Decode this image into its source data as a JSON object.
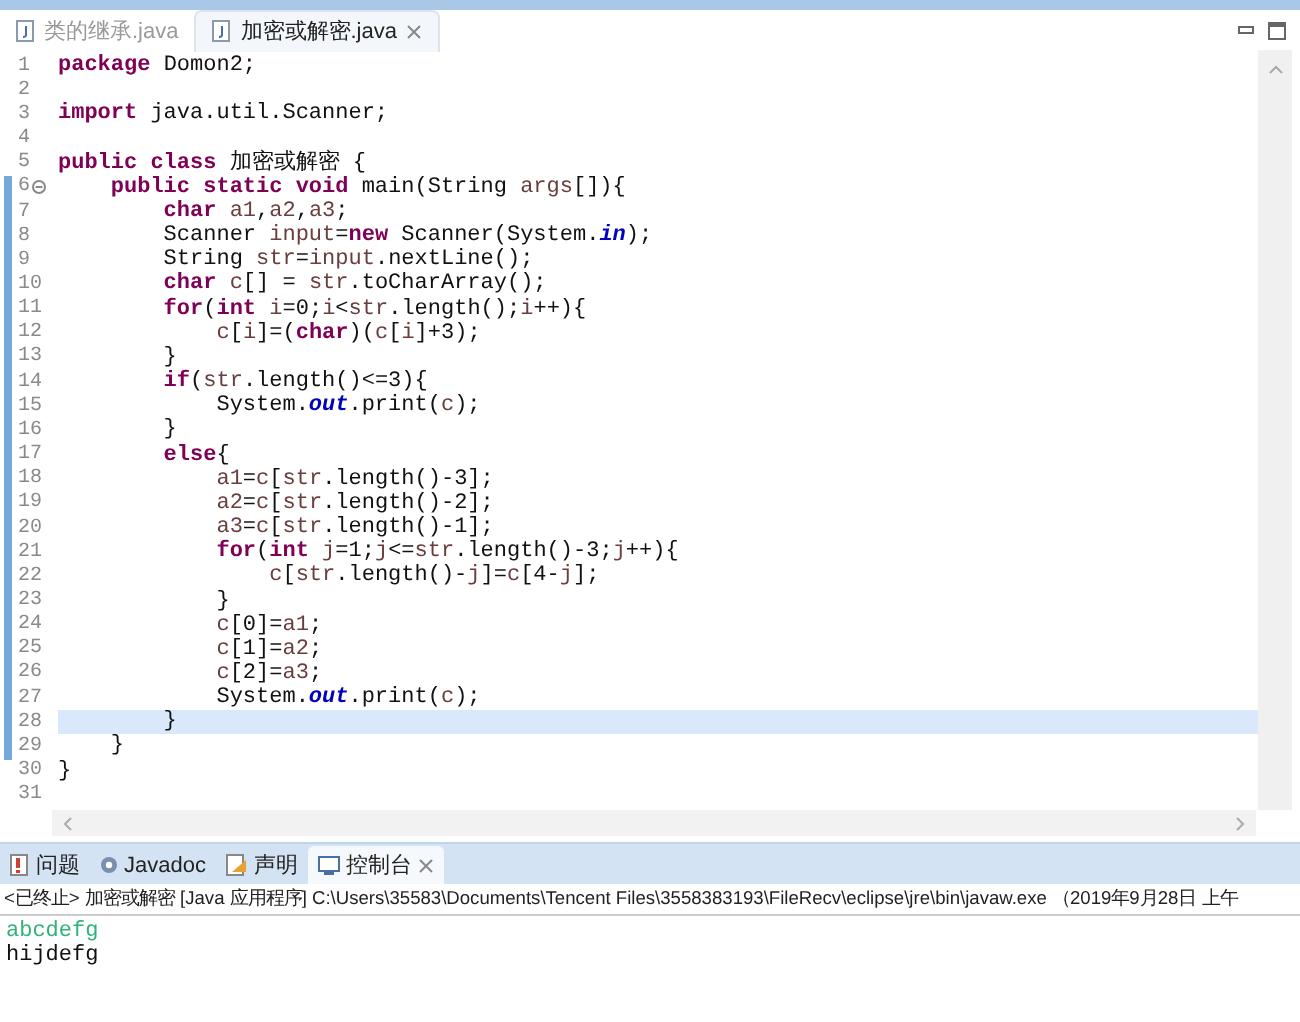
{
  "editor_tabs": [
    {
      "label": "类的继承.java",
      "selected": false
    },
    {
      "label": "加密或解密.java",
      "selected": true
    }
  ],
  "code_lines": [
    {
      "number": "1",
      "changed": false,
      "current": false,
      "fold": false,
      "tokens": [
        {
          "kind": "keyword",
          "text": "package"
        },
        {
          "kind": "plain",
          "text": " Domon2;"
        }
      ]
    },
    {
      "number": "2",
      "changed": false,
      "current": false,
      "fold": false
    },
    {
      "number": "3",
      "changed": false,
      "current": false,
      "fold": false,
      "tokens": [
        {
          "kind": "keyword",
          "text": "import"
        },
        {
          "kind": "plain",
          "text": " java.util.Scanner;"
        }
      ]
    },
    {
      "number": "4",
      "changed": false,
      "current": false,
      "fold": false
    },
    {
      "number": "5",
      "changed": false,
      "current": false,
      "fold": false,
      "tokens": [
        {
          "kind": "keyword",
          "text": "public class"
        },
        {
          "kind": "plain",
          "text": " 加密或解密 {"
        }
      ]
    },
    {
      "number": "6",
      "changed": true,
      "current": false,
      "fold": true,
      "tokens": [
        {
          "kind": "keyword",
          "text": "    public static void"
        },
        {
          "kind": "plain",
          "text": " main(String "
        },
        {
          "kind": "variable",
          "text": "args"
        },
        {
          "kind": "plain",
          "text": "[]){"
        }
      ]
    },
    {
      "number": "7",
      "changed": true,
      "current": false,
      "fold": false,
      "tokens": [
        {
          "kind": "keyword",
          "text": "        char"
        },
        {
          "kind": "variable",
          "text": " a1"
        },
        {
          "kind": "plain",
          "text": ","
        },
        {
          "kind": "variable",
          "text": "a2"
        },
        {
          "kind": "plain",
          "text": ","
        },
        {
          "kind": "variable",
          "text": "a3"
        },
        {
          "kind": "plain",
          "text": ";"
        }
      ]
    },
    {
      "number": "8",
      "changed": true,
      "current": false,
      "fold": false,
      "tokens": [
        {
          "kind": "plain",
          "text": "        Scanner "
        },
        {
          "kind": "variable",
          "text": "input"
        },
        {
          "kind": "plain",
          "text": "="
        },
        {
          "kind": "keyword",
          "text": "new"
        },
        {
          "kind": "plain",
          "text": " Scanner(System."
        },
        {
          "kind": "field",
          "text": "in"
        },
        {
          "kind": "plain",
          "text": ");"
        }
      ]
    },
    {
      "number": "9",
      "changed": true,
      "current": false,
      "fold": false,
      "tokens": [
        {
          "kind": "plain",
          "text": "        String "
        },
        {
          "kind": "variable",
          "text": "str"
        },
        {
          "kind": "plain",
          "text": "="
        },
        {
          "kind": "variable",
          "text": "input"
        },
        {
          "kind": "plain",
          "text": ".nextLine();"
        }
      ]
    },
    {
      "number": "10",
      "changed": true,
      "current": false,
      "fold": false,
      "tokens": [
        {
          "kind": "keyword",
          "text": "        char"
        },
        {
          "kind": "variable",
          "text": " c"
        },
        {
          "kind": "plain",
          "text": "[] = "
        },
        {
          "kind": "variable",
          "text": "str"
        },
        {
          "kind": "plain",
          "text": ".toCharArray();"
        }
      ]
    },
    {
      "number": "11",
      "changed": true,
      "current": false,
      "fold": false,
      "tokens": [
        {
          "kind": "keyword",
          "text": "        for"
        },
        {
          "kind": "plain",
          "text": "("
        },
        {
          "kind": "keyword",
          "text": "int"
        },
        {
          "kind": "variable",
          "text": " i"
        },
        {
          "kind": "plain",
          "text": "=0;"
        },
        {
          "kind": "variable",
          "text": "i"
        },
        {
          "kind": "plain",
          "text": "<"
        },
        {
          "kind": "variable",
          "text": "str"
        },
        {
          "kind": "plain",
          "text": ".length();"
        },
        {
          "kind": "variable",
          "text": "i"
        },
        {
          "kind": "plain",
          "text": "++){"
        }
      ]
    },
    {
      "number": "12",
      "changed": true,
      "current": false,
      "fold": false,
      "tokens": [
        {
          "kind": "variable",
          "text": "            c"
        },
        {
          "kind": "plain",
          "text": "["
        },
        {
          "kind": "variable",
          "text": "i"
        },
        {
          "kind": "plain",
          "text": "]=("
        },
        {
          "kind": "keyword",
          "text": "char"
        },
        {
          "kind": "plain",
          "text": ")("
        },
        {
          "kind": "variable",
          "text": "c"
        },
        {
          "kind": "plain",
          "text": "["
        },
        {
          "kind": "variable",
          "text": "i"
        },
        {
          "kind": "plain",
          "text": "]+3);"
        }
      ]
    },
    {
      "number": "13",
      "changed": true,
      "current": false,
      "fold": false,
      "tokens": [
        {
          "kind": "plain",
          "text": "        }"
        }
      ]
    },
    {
      "number": "14",
      "changed": true,
      "current": false,
      "fold": false,
      "tokens": [
        {
          "kind": "keyword",
          "text": "        if"
        },
        {
          "kind": "plain",
          "text": "("
        },
        {
          "kind": "variable",
          "text": "str"
        },
        {
          "kind": "plain",
          "text": ".length()<=3){"
        }
      ]
    },
    {
      "number": "15",
      "changed": true,
      "current": false,
      "fold": false,
      "tokens": [
        {
          "kind": "plain",
          "text": "            System."
        },
        {
          "kind": "field",
          "text": "out"
        },
        {
          "kind": "plain",
          "text": ".print("
        },
        {
          "kind": "variable",
          "text": "c"
        },
        {
          "kind": "plain",
          "text": ");"
        }
      ]
    },
    {
      "number": "16",
      "changed": true,
      "current": false,
      "fold": false,
      "tokens": [
        {
          "kind": "plain",
          "text": "        }"
        }
      ]
    },
    {
      "number": "17",
      "changed": true,
      "current": false,
      "fold": false,
      "tokens": [
        {
          "kind": "keyword",
          "text": "        else"
        },
        {
          "kind": "plain",
          "text": "{"
        }
      ]
    },
    {
      "number": "18",
      "changed": true,
      "current": false,
      "fold": false,
      "tokens": [
        {
          "kind": "variable",
          "text": "            a1"
        },
        {
          "kind": "plain",
          "text": "="
        },
        {
          "kind": "variable",
          "text": "c"
        },
        {
          "kind": "plain",
          "text": "["
        },
        {
          "kind": "variable",
          "text": "str"
        },
        {
          "kind": "plain",
          "text": ".length()-3];"
        }
      ]
    },
    {
      "number": "19",
      "changed": true,
      "current": false,
      "fold": false,
      "tokens": [
        {
          "kind": "variable",
          "text": "            a2"
        },
        {
          "kind": "plain",
          "text": "="
        },
        {
          "kind": "variable",
          "text": "c"
        },
        {
          "kind": "plain",
          "text": "["
        },
        {
          "kind": "variable",
          "text": "str"
        },
        {
          "kind": "plain",
          "text": ".length()-2];"
        }
      ]
    },
    {
      "number": "20",
      "changed": true,
      "current": false,
      "fold": false,
      "tokens": [
        {
          "kind": "variable",
          "text": "            a3"
        },
        {
          "kind": "plain",
          "text": "="
        },
        {
          "kind": "variable",
          "text": "c"
        },
        {
          "kind": "plain",
          "text": "["
        },
        {
          "kind": "variable",
          "text": "str"
        },
        {
          "kind": "plain",
          "text": ".length()-1];"
        }
      ]
    },
    {
      "number": "21",
      "changed": true,
      "current": false,
      "fold": false,
      "tokens": [
        {
          "kind": "keyword",
          "text": "            for"
        },
        {
          "kind": "plain",
          "text": "("
        },
        {
          "kind": "keyword",
          "text": "int"
        },
        {
          "kind": "variable",
          "text": " j"
        },
        {
          "kind": "plain",
          "text": "=1;"
        },
        {
          "kind": "variable",
          "text": "j"
        },
        {
          "kind": "plain",
          "text": "<="
        },
        {
          "kind": "variable",
          "text": "str"
        },
        {
          "kind": "plain",
          "text": ".length()-3;"
        },
        {
          "kind": "variable",
          "text": "j"
        },
        {
          "kind": "plain",
          "text": "++){"
        }
      ]
    },
    {
      "number": "22",
      "changed": true,
      "current": false,
      "fold": false,
      "tokens": [
        {
          "kind": "variable",
          "text": "                c"
        },
        {
          "kind": "plain",
          "text": "["
        },
        {
          "kind": "variable",
          "text": "str"
        },
        {
          "kind": "plain",
          "text": ".length()-"
        },
        {
          "kind": "variable",
          "text": "j"
        },
        {
          "kind": "plain",
          "text": "]="
        },
        {
          "kind": "variable",
          "text": "c"
        },
        {
          "kind": "plain",
          "text": "[4-"
        },
        {
          "kind": "variable",
          "text": "j"
        },
        {
          "kind": "plain",
          "text": "];"
        }
      ]
    },
    {
      "number": "23",
      "changed": true,
      "current": false,
      "fold": false,
      "tokens": [
        {
          "kind": "plain",
          "text": "            }"
        }
      ]
    },
    {
      "number": "24",
      "changed": true,
      "current": false,
      "fold": false,
      "tokens": [
        {
          "kind": "variable",
          "text": "            c"
        },
        {
          "kind": "plain",
          "text": "[0]="
        },
        {
          "kind": "variable",
          "text": "a1"
        },
        {
          "kind": "plain",
          "text": ";"
        }
      ]
    },
    {
      "number": "25",
      "changed": true,
      "current": false,
      "fold": false,
      "tokens": [
        {
          "kind": "variable",
          "text": "            c"
        },
        {
          "kind": "plain",
          "text": "[1]="
        },
        {
          "kind": "variable",
          "text": "a2"
        },
        {
          "kind": "plain",
          "text": ";"
        }
      ]
    },
    {
      "number": "26",
      "changed": true,
      "current": false,
      "fold": false,
      "tokens": [
        {
          "kind": "variable",
          "text": "            c"
        },
        {
          "kind": "plain",
          "text": "[2]="
        },
        {
          "kind": "variable",
          "text": "a3"
        },
        {
          "kind": "plain",
          "text": ";"
        }
      ]
    },
    {
      "number": "27",
      "changed": true,
      "current": false,
      "fold": false,
      "tokens": [
        {
          "kind": "plain",
          "text": "            System."
        },
        {
          "kind": "field",
          "text": "out"
        },
        {
          "kind": "plain",
          "text": ".print("
        },
        {
          "kind": "variable",
          "text": "c"
        },
        {
          "kind": "plain",
          "text": ");"
        }
      ]
    },
    {
      "number": "28",
      "changed": true,
      "current": true,
      "fold": false,
      "tokens": [
        {
          "kind": "plain",
          "text": "        }"
        }
      ]
    },
    {
      "number": "29",
      "changed": true,
      "current": false,
      "fold": false,
      "tokens": [
        {
          "kind": "plain",
          "text": "    }"
        }
      ]
    },
    {
      "number": "30",
      "changed": false,
      "current": false,
      "fold": false,
      "tokens": [
        {
          "kind": "plain",
          "text": "}"
        }
      ]
    },
    {
      "number": "31",
      "changed": false,
      "current": false,
      "fold": false
    }
  ],
  "view_tabs": [
    {
      "kind": "problems",
      "label": "问题",
      "selected": false
    },
    {
      "kind": "javadoc",
      "label": "Javadoc",
      "selected": false
    },
    {
      "kind": "declaration",
      "label": "声明",
      "selected": false
    },
    {
      "kind": "console",
      "label": "控制台",
      "selected": true
    }
  ],
  "console": {
    "header": "<已终止> 加密或解密 [Java 应用程序] C:\\Users\\35583\\Documents\\Tencent Files\\3558383193\\FileRecv\\eclipse\\jre\\bin\\javaw.exe （2019年9月28日 上午",
    "lines": [
      {
        "kind": "input",
        "text": "abcdefg"
      },
      {
        "kind": "output",
        "text": "hijdefg"
      }
    ]
  }
}
